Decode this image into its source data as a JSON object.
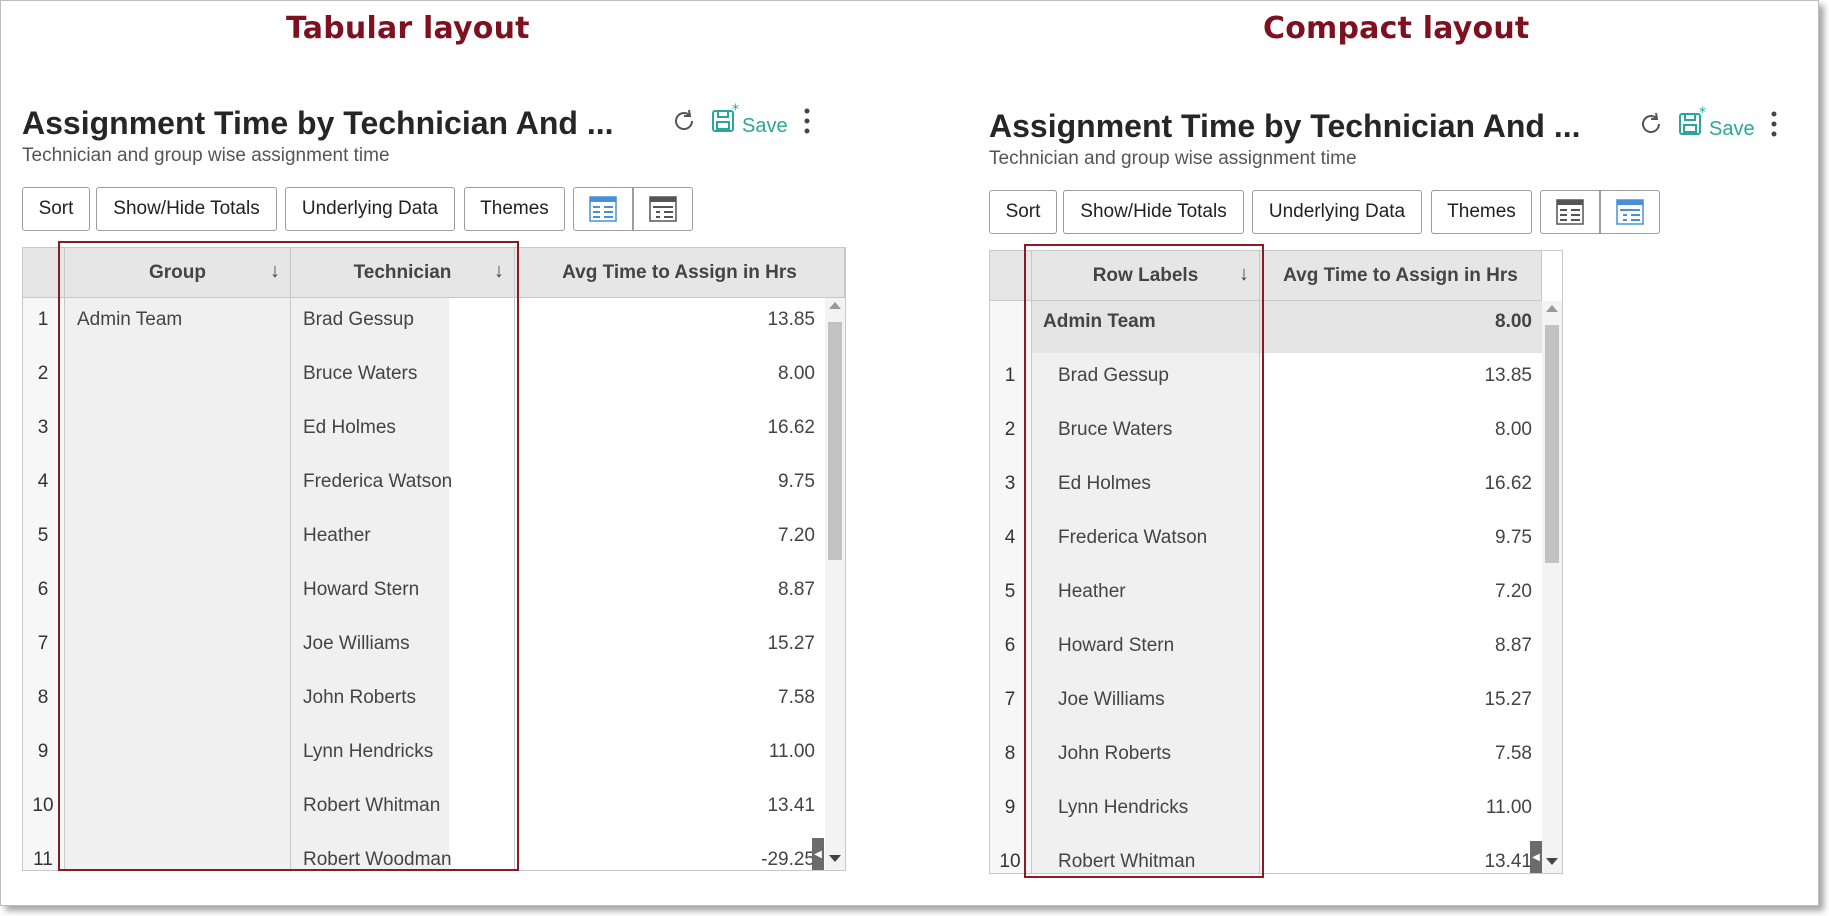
{
  "captions": {
    "left": "Tabular layout",
    "right": "Compact layout"
  },
  "report": {
    "title": "Assignment Time by Technician And ...",
    "subtitle": "Technician and group wise assignment time",
    "save_label": "Save",
    "icons": [
      "refresh-icon",
      "save-icon",
      "more-vertical-icon",
      "tabular-view-icon",
      "compact-view-icon"
    ]
  },
  "toolbar": {
    "sort": "Sort",
    "totals": "Show/Hide Totals",
    "underlying": "Underlying Data",
    "themes": "Themes"
  },
  "tabular": {
    "headers": {
      "group": "Group",
      "technician": "Technician",
      "value": "Avg Time to Assign in Hrs"
    },
    "sort_arrow": "↓",
    "group_name": "Admin Team",
    "rows": [
      {
        "n": "1",
        "tech": "Brad Gessup",
        "value": "13.85"
      },
      {
        "n": "2",
        "tech": "Bruce Waters",
        "value": "8.00"
      },
      {
        "n": "3",
        "tech": "Ed Holmes",
        "value": "16.62"
      },
      {
        "n": "4",
        "tech": "Frederica Watson",
        "value": "9.75"
      },
      {
        "n": "5",
        "tech": "Heather",
        "value": "7.20"
      },
      {
        "n": "6",
        "tech": "Howard Stern",
        "value": "8.87"
      },
      {
        "n": "7",
        "tech": "Joe Williams",
        "value": "15.27"
      },
      {
        "n": "8",
        "tech": "John Roberts",
        "value": "7.58"
      },
      {
        "n": "9",
        "tech": "Lynn Hendricks",
        "value": "11.00"
      },
      {
        "n": "10",
        "tech": "Robert Whitman",
        "value": "13.41"
      },
      {
        "n": "11",
        "tech": "Robert Woodman",
        "value": "-29.25"
      }
    ]
  },
  "compact": {
    "headers": {
      "labels": "Row Labels",
      "value": "Avg Time to Assign in Hrs"
    },
    "sort_arrow": "↓",
    "group": {
      "name": "Admin Team",
      "value": "8.00"
    },
    "rows": [
      {
        "n": "1",
        "tech": "Brad Gessup",
        "value": "13.85"
      },
      {
        "n": "2",
        "tech": "Bruce Waters",
        "value": "8.00"
      },
      {
        "n": "3",
        "tech": "Ed Holmes",
        "value": "16.62"
      },
      {
        "n": "4",
        "tech": "Frederica Watson",
        "value": "9.75"
      },
      {
        "n": "5",
        "tech": "Heather",
        "value": "7.20"
      },
      {
        "n": "6",
        "tech": "Howard Stern",
        "value": "8.87"
      },
      {
        "n": "7",
        "tech": "Joe Williams",
        "value": "15.27"
      },
      {
        "n": "8",
        "tech": "John Roberts",
        "value": "7.58"
      },
      {
        "n": "9",
        "tech": "Lynn Hendricks",
        "value": "11.00"
      },
      {
        "n": "10",
        "tech": "Robert Whitman",
        "value": "13.41"
      }
    ]
  },
  "colors": {
    "caption": "#7f1020",
    "highlight_box": "#8b1a25",
    "save_accent": "#2aa79a",
    "view_active": "#4a90d9"
  }
}
